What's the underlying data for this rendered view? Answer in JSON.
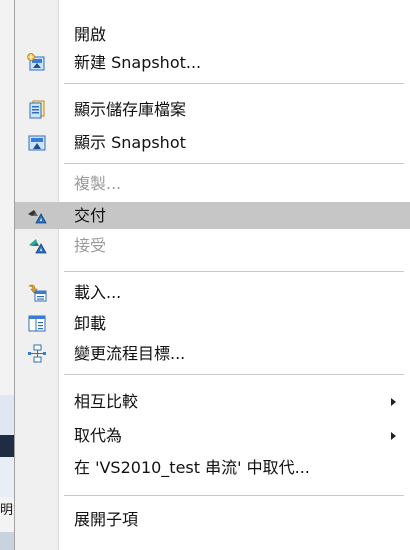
{
  "background_window": {
    "fragment_text": "明玄"
  },
  "context_menu": {
    "groups": [
      [
        {
          "label": "開啟",
          "icon": "none",
          "enabled": true
        },
        {
          "label": "新建 Snapshot...",
          "icon": "new-snapshot-icon",
          "enabled": true
        }
      ],
      [
        {
          "label": "顯示儲存庫檔案",
          "icon": "repository-files-icon",
          "enabled": true
        },
        {
          "label": "顯示 Snapshot",
          "icon": "snapshot-icon",
          "enabled": true
        }
      ],
      [
        {
          "label": "複製...",
          "icon": "none",
          "enabled": false
        },
        {
          "label": "交付",
          "icon": "deliver-icon",
          "enabled": true,
          "highlighted": true
        },
        {
          "label": "接受",
          "icon": "accept-icon",
          "enabled": false
        }
      ],
      [
        {
          "label": "載入...",
          "icon": "load-icon",
          "enabled": true
        },
        {
          "label": "卸載",
          "icon": "unload-icon",
          "enabled": true
        },
        {
          "label": "變更流程目標...",
          "icon": "change-flow-target-icon",
          "enabled": true
        }
      ],
      [
        {
          "label": "相互比較",
          "icon": "none",
          "enabled": true,
          "submenu": true
        },
        {
          "label": "取代為",
          "icon": "none",
          "enabled": true,
          "submenu": true
        },
        {
          "label": "在 'VS2010_test 串流' 中取代...",
          "icon": "none",
          "enabled": true
        }
      ],
      [
        {
          "label": "展開子項",
          "icon": "none",
          "enabled": true
        }
      ]
    ]
  },
  "colors": {
    "highlight": "#c6c6c6",
    "disabled_text": "#9a9a9a",
    "gutter": "#f0f0f0",
    "icon_blue": "#3a7bd5",
    "icon_orange": "#e8a020",
    "icon_teal": "#19a3a3"
  }
}
